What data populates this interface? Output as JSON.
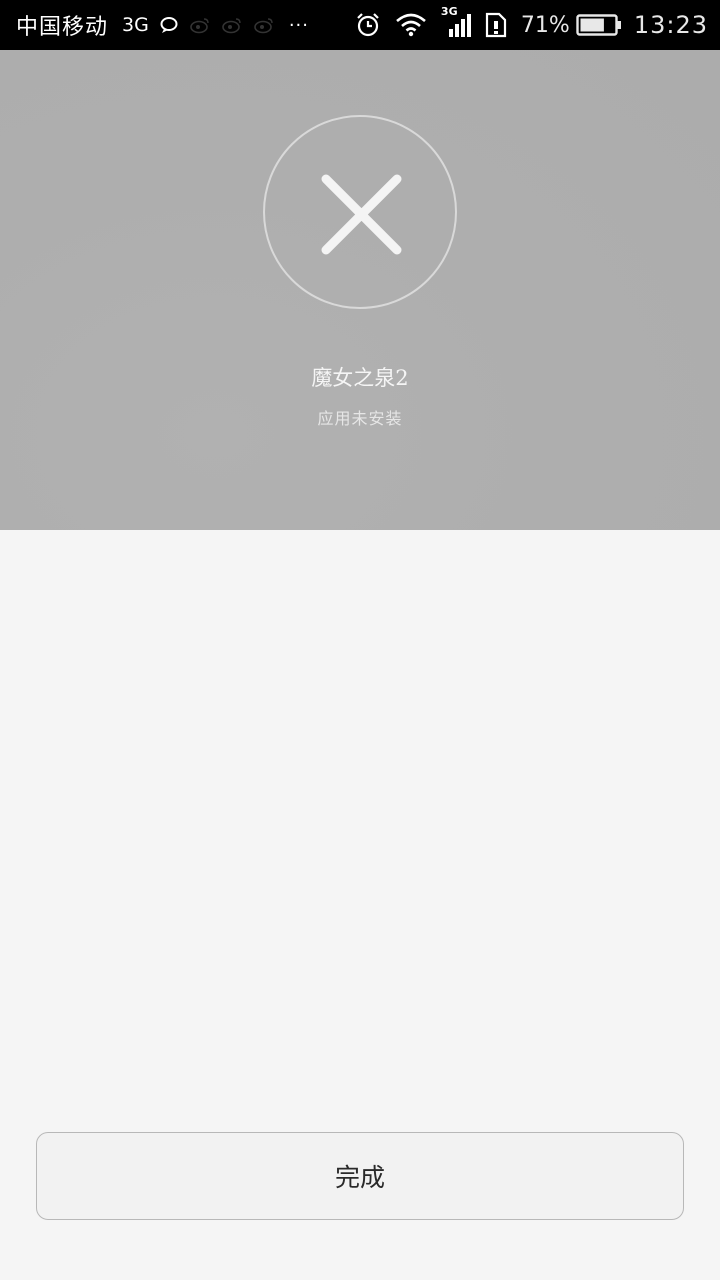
{
  "status_bar": {
    "carrier": "中国移动",
    "network_type": "3G",
    "signal_label": "3G",
    "more": "···",
    "battery_percent": "71%",
    "battery_level": 0.71,
    "time": "13:23"
  },
  "result": {
    "icon": "close-icon",
    "app_name": "魔女之泉2",
    "status": "应用未安装"
  },
  "actions": {
    "done_label": "完成"
  }
}
